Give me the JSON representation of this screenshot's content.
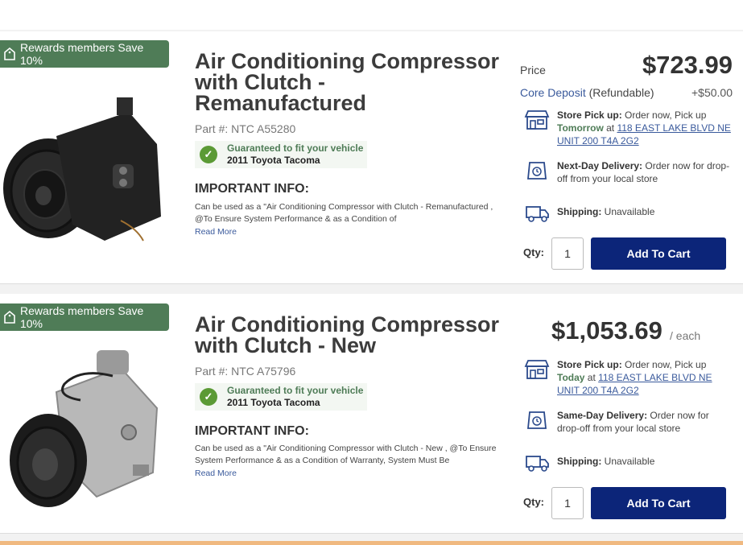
{
  "products": [
    {
      "badge": "Rewards members Save 10%",
      "title": "Air Conditioning Compressor with Clutch - Remanufactured",
      "part_number": "Part #: NTC A55280",
      "fit_guarantee": "Guaranteed to fit your vehicle",
      "vehicle": "2011 Toyota Tacoma",
      "important_heading": "IMPORTANT INFO:",
      "important_text": "Can be used as a \"Air Conditioning Compressor with Clutch - Remanufactured , @To Ensure System Performance & as a Condition of",
      "read_more": "Read More",
      "price_label": "Price",
      "price": "$723.99",
      "core_link": "Core Deposit",
      "core_note": " (Refundable)",
      "core_amount": "+$50.00",
      "pickup_label": "Store Pick up:",
      "pickup_text": " Order now, Pick up ",
      "pickup_when": "Tomorrow",
      "pickup_at": " at ",
      "pickup_address": "118 EAST LAKE BLVD NE UNIT 200 T4A 2G2",
      "delivery_label": "Next-Day Delivery:",
      "delivery_text": " Order now for drop-off from your local store",
      "shipping_label": "Shipping:",
      "shipping_text": " Unavailable",
      "qty_label": "Qty:",
      "qty": "1",
      "cart_label": "Add To Cart"
    },
    {
      "badge": "Rewards members Save 10%",
      "title": "Air Conditioning Compressor with Clutch - New",
      "part_number": "Part #: NTC A75796",
      "fit_guarantee": "Guaranteed to fit your vehicle",
      "vehicle": "2011 Toyota Tacoma",
      "important_heading": "IMPORTANT INFO:",
      "important_text": "Can be used as a \"Air Conditioning Compressor with Clutch - New , @To Ensure System Performance & as a Condition of Warranty, System Must Be",
      "read_more": "Read More",
      "price": "$1,053.69",
      "price_unit": "/ each",
      "pickup_label": "Store Pick up:",
      "pickup_text": " Order now, Pick up ",
      "pickup_when": "Today",
      "pickup_at": " at ",
      "pickup_address": "118 EAST LAKE BLVD NE UNIT 200 T4A 2G2",
      "delivery_label": "Same-Day Delivery:",
      "delivery_text": " Order now for drop-off from your local store",
      "shipping_label": "Shipping:",
      "shipping_text": " Unavailable",
      "qty_label": "Qty:",
      "qty": "1",
      "cart_label": "Add To Cart"
    }
  ],
  "colors": {
    "badge_bg": "#4f7c57",
    "cart_button": "#0c2579",
    "link": "#3a5a9c",
    "fit_check": "#5b9a35"
  },
  "icons": [
    "tag-icon",
    "check-circle-icon",
    "store-icon",
    "delivery-clock-icon",
    "shipping-truck-icon"
  ]
}
